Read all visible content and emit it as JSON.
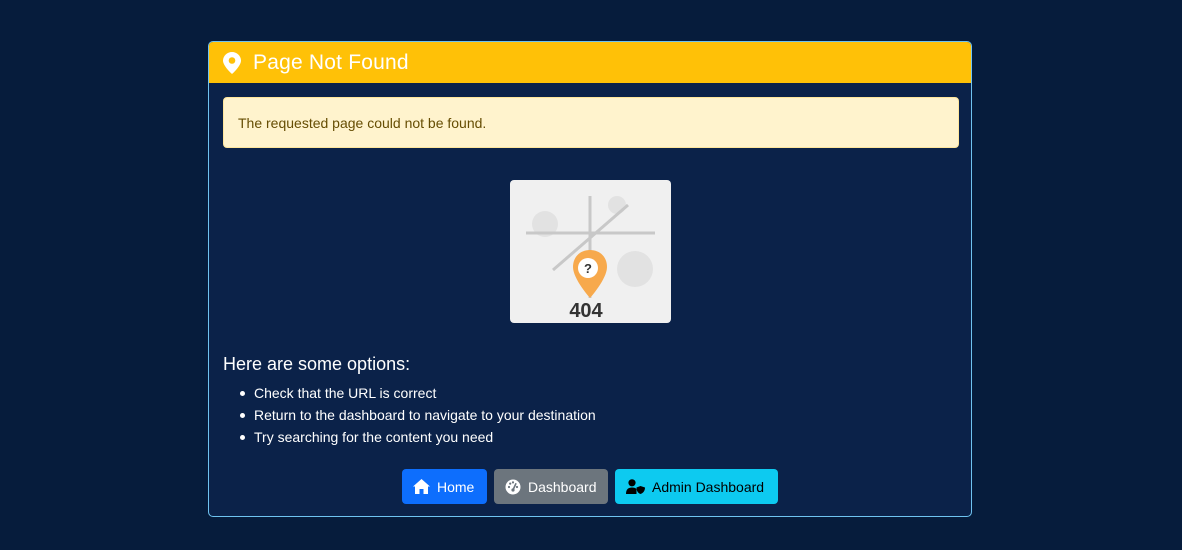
{
  "header": {
    "title": "Page Not Found",
    "icon": "map-marker-icon",
    "color": "#ffc107"
  },
  "alert": {
    "message": "The requested page could not be found."
  },
  "illustration": {
    "code": "404",
    "marker_symbol": "?"
  },
  "options": {
    "title": "Here are some options:",
    "items": [
      "Check that the URL is correct",
      "Return to the dashboard to navigate to your destination",
      "Try searching for the content you need"
    ]
  },
  "buttons": {
    "home": {
      "label": "Home",
      "icon": "home-icon",
      "color": "#0d6efd"
    },
    "dashboard": {
      "label": "Dashboard",
      "icon": "tachometer-icon",
      "color": "#6c757d"
    },
    "admin": {
      "label": "Admin Dashboard",
      "icon": "user-shield-icon",
      "color": "#0dcaf0"
    }
  },
  "theme": {
    "background": "#061c3c",
    "card_background": "#0b2249",
    "card_border": "#6fc3f0"
  }
}
